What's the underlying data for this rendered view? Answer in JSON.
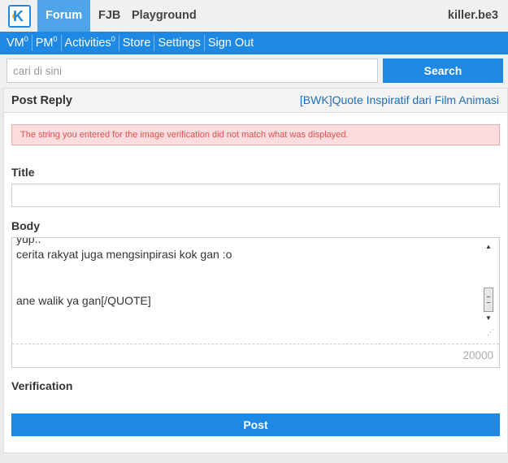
{
  "topbar": {
    "logo_letter": "K",
    "tabs": [
      {
        "label": "Forum",
        "active": true
      },
      {
        "label": "FJB",
        "active": false
      },
      {
        "label": "Playground",
        "active": false
      }
    ],
    "username": "killer.be3"
  },
  "subnav": {
    "items": [
      {
        "label": "VM",
        "count": "0"
      },
      {
        "label": "PM",
        "count": "0"
      },
      {
        "label": "Activities",
        "count": "0"
      },
      {
        "label": "Store"
      },
      {
        "label": "Settings"
      },
      {
        "label": "Sign Out"
      }
    ]
  },
  "search": {
    "placeholder": "cari di sini",
    "button_label": "Search"
  },
  "panel": {
    "title": "Post Reply",
    "thread_title": "[BWK]Quote Inspiratif dari Film Animasi",
    "error_message": "The string you entered for the image verification did not match what was displayed."
  },
  "form": {
    "title_label": "Title",
    "title_value": "",
    "body_label": "Body",
    "body_text": "yup..\ncerita rakyat juga mengsinpirasi kok gan :o\n\n\nane walik ya gan[/QUOTE]",
    "char_limit": "20000",
    "verification_label": "Verification",
    "post_button_label": "Post"
  },
  "colors": {
    "accent": "#1e88e5",
    "active_tab": "#4fa3e9",
    "error_bg": "#fcdcdc",
    "error_text": "#e05050"
  }
}
